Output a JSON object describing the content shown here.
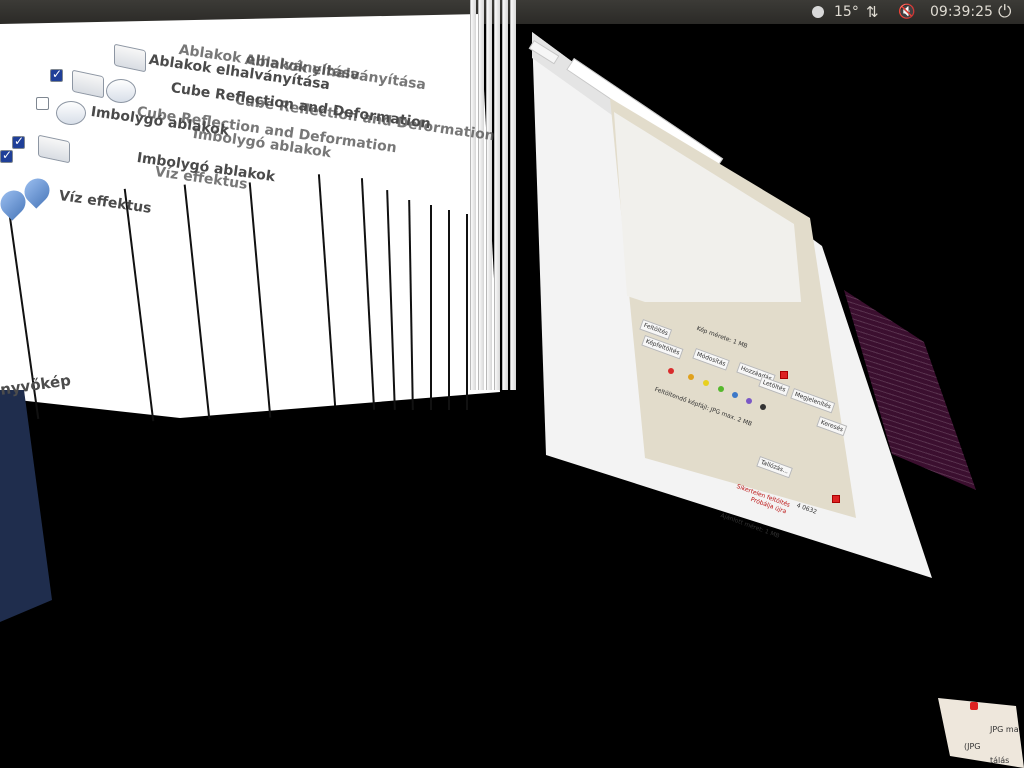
{
  "top_panel": {
    "temperature": "15°",
    "clock": "09:39:25",
    "icons": [
      "weather-icon",
      "network-icon",
      "volume-muted-icon",
      "power-icon"
    ]
  },
  "effects_window": {
    "items": [
      {
        "label": "Ablakok elhalványítása",
        "checked": true
      },
      {
        "label": "Ablakok elhalványítása",
        "checked": true
      },
      {
        "label": "Cube Reflection and Deformation",
        "checked": true
      },
      {
        "label": "Cube Reflection and Deformation",
        "checked": false
      },
      {
        "label": "Imbolygó ablakok",
        "checked": true
      },
      {
        "label": "Imbolygó ablakok",
        "checked": true
      },
      {
        "label": "Víz effektus",
        "checked": false
      }
    ],
    "footer_label": "nyvőkép"
  },
  "browser_window": {
    "buttons": [
      "Feltöltés",
      "Képfeltöltés",
      "Módosítás",
      "Hozzáadás",
      "Letöltés",
      "Megjelenítés",
      "Keresés"
    ],
    "notice_1": "Kép mérete: 1 MB",
    "upload_label": "Feltöltendő képfájl: JPG max. 2 MB",
    "button_select": "Tallózás...",
    "status_red": "Sikertelen feltöltés",
    "status_red_2": "Próbálja újra",
    "code": "4 0632",
    "bottom_text": "Ajánlott méret: 1 MB",
    "colors": [
      "#d92c2c",
      "#e0a11c",
      "#e8d01e",
      "#55b82c",
      "#3c78c8",
      "#7a58c6",
      "#333333"
    ]
  },
  "thumbnail": {
    "text_1": "JPG ma",
    "text_2": "(JPG",
    "text_3": "tálás"
  }
}
